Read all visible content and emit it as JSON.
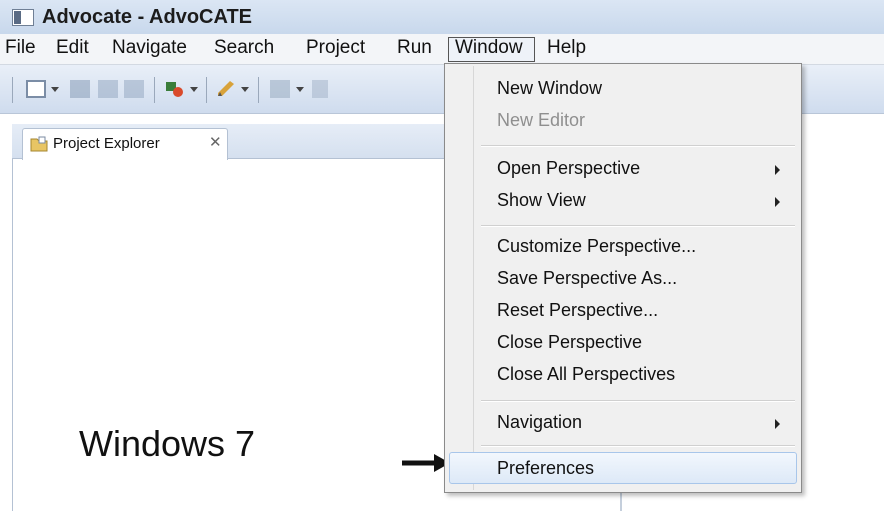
{
  "window": {
    "title": "Advocate - AdvoCATE"
  },
  "menubar": {
    "items": [
      "File",
      "Edit",
      "Navigate",
      "Search",
      "Project",
      "Run",
      "Window",
      "Help"
    ],
    "active": "Window"
  },
  "toolbar": {
    "icons": [
      "new-file-icon",
      "save-icon",
      "save-all-icon",
      "print-icon",
      "run-icon",
      "pencil-icon",
      "navigate-icon",
      "search-icon"
    ]
  },
  "view": {
    "tab_label": "Project Explorer",
    "tab_close_glyph": "✕"
  },
  "window_menu": {
    "items": {
      "new_window": "New Window",
      "new_editor": "New Editor",
      "open_perspective": "Open Perspective",
      "show_view": "Show View",
      "customize_perspective": "Customize Perspective...",
      "save_perspective_as": "Save Perspective As...",
      "reset_perspective": "Reset Perspective...",
      "close_perspective": "Close Perspective",
      "close_all_perspectives": "Close All Perspectives",
      "navigation": "Navigation",
      "preferences": "Preferences"
    },
    "disabled": [
      "new_editor"
    ],
    "highlighted": "preferences"
  },
  "annotation": {
    "os_label": "Windows 7",
    "arrow_icon": "right-arrow-icon"
  },
  "colors": {
    "menu_highlight": "#dde9f7",
    "title_bar": "#c8d8ec",
    "toolbar": "#cfdcee"
  }
}
